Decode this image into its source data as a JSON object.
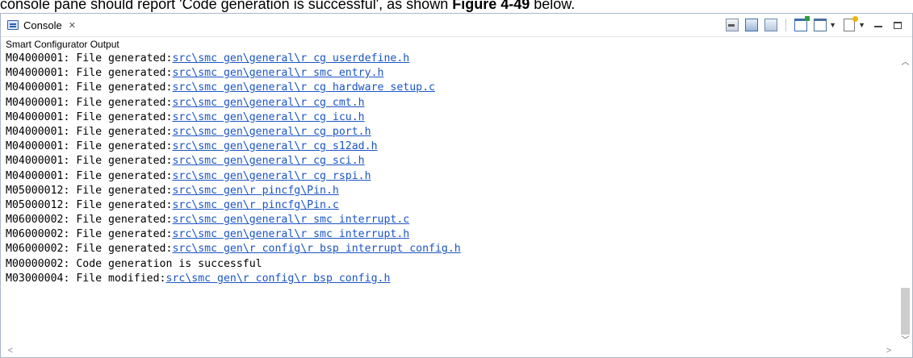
{
  "caption": {
    "text_before": "console pane should report 'Code generation is successful', as shown ",
    "bold": "Figure 4-49",
    "text_after": " below."
  },
  "tab": {
    "label": "Console",
    "close_glyph": "✕"
  },
  "toolbar": {
    "icons": [
      "clear-console-icon",
      "scroll-lock-icon",
      "pin-console-icon",
      "open-console-icon",
      "display-console-icon",
      "new-console-icon",
      "minimize-icon",
      "maximize-icon"
    ]
  },
  "subtitle": "Smart Configurator Output",
  "lines": [
    {
      "prefix": "M04000001: File generated:",
      "link": "src\\smc gen\\general\\r cg userdefine.h"
    },
    {
      "prefix": "M04000001: File generated:",
      "link": "src\\smc gen\\general\\r smc entry.h"
    },
    {
      "prefix": "M04000001: File generated:",
      "link": "src\\smc gen\\general\\r cg hardware setup.c"
    },
    {
      "prefix": "M04000001: File generated:",
      "link": "src\\smc gen\\general\\r cg cmt.h"
    },
    {
      "prefix": "M04000001: File generated:",
      "link": "src\\smc gen\\general\\r cg icu.h"
    },
    {
      "prefix": "M04000001: File generated:",
      "link": "src\\smc gen\\general\\r cg port.h"
    },
    {
      "prefix": "M04000001: File generated:",
      "link": "src\\smc gen\\general\\r cg s12ad.h"
    },
    {
      "prefix": "M04000001: File generated:",
      "link": "src\\smc gen\\general\\r cg sci.h"
    },
    {
      "prefix": "M04000001: File generated:",
      "link": "src\\smc gen\\general\\r cg rspi.h"
    },
    {
      "prefix": "M05000012: File generated:",
      "link": "src\\smc gen\\r pincfg\\Pin.h"
    },
    {
      "prefix": "M05000012: File generated:",
      "link": "src\\smc gen\\r pincfg\\Pin.c"
    },
    {
      "prefix": "M06000002: File generated:",
      "link": "src\\smc gen\\general\\r smc interrupt.c"
    },
    {
      "prefix": "M06000002: File generated:",
      "link": "src\\smc gen\\general\\r smc interrupt.h"
    },
    {
      "prefix": "M06000002: File generated:",
      "link": "src\\smc gen\\r config\\r bsp interrupt config.h"
    },
    {
      "prefix": "M00000002: Code generation is successful",
      "link": ""
    },
    {
      "prefix": "M03000004: File modified:",
      "link": "src\\smc gen\\r config\\r bsp config.h"
    }
  ]
}
